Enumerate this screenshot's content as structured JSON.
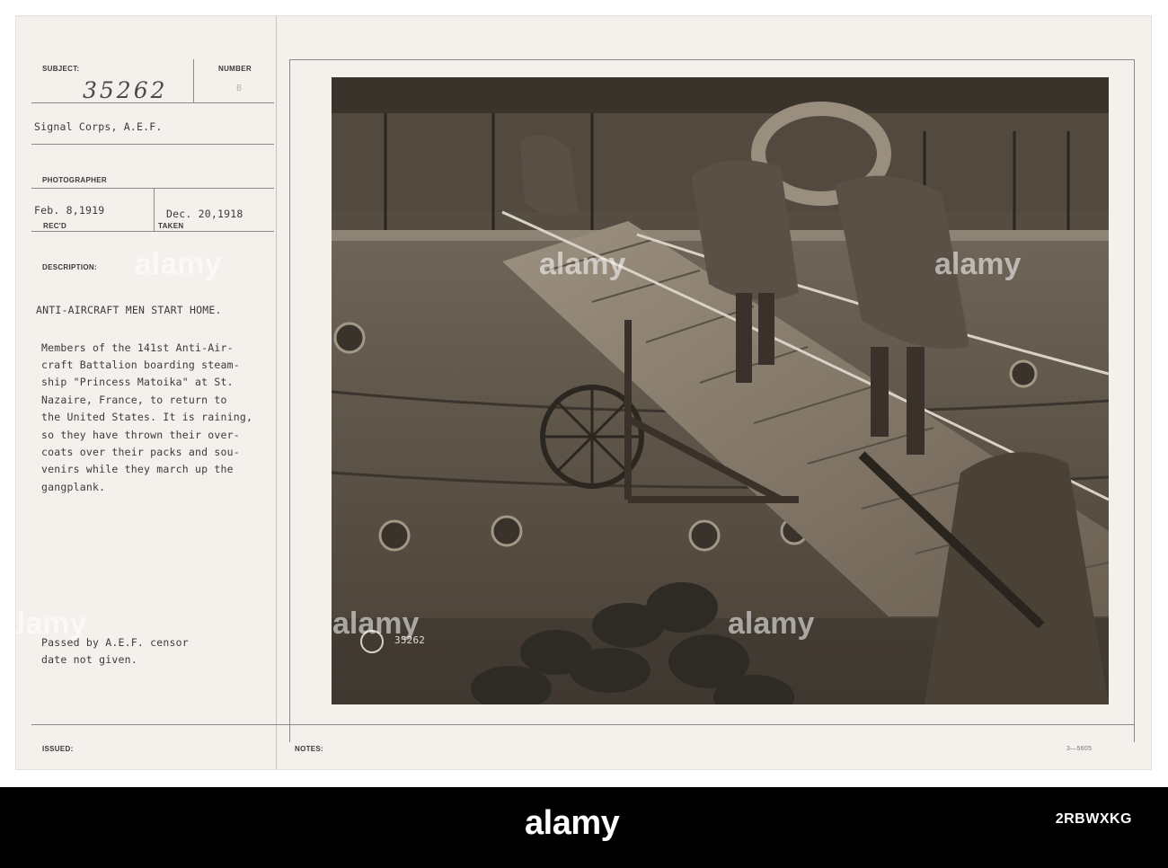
{
  "card": {
    "subject_label": "SUBJECT:",
    "number_label": "NUMBER",
    "subject_number": "35262",
    "number_value": "B",
    "source": "Signal Corps, A.E.F.",
    "photographer_label": "PHOTOGRAPHER",
    "received_date": "Feb. 8,1919",
    "received_label": "REC'D",
    "taken_date": "Dec. 20,1918",
    "taken_label": "TAKEN",
    "description_label": "DESCRIPTION:",
    "headline": "ANTI-AIRCRAFT MEN START HOME.",
    "description_lines": [
      "Members of the 141st Anti-Air-",
      "craft Battalion boarding steam-",
      "ship \"Princess Matoika\" at St.",
      "Nazaire, France, to return to",
      "the United States. It is raining,",
      "so they have thrown their over-",
      "coats over their packs and sou-",
      "venirs while they march up the",
      "gangplank."
    ],
    "censor_lines": [
      "Passed by A.E.F. censor",
      "date not given."
    ],
    "issued_label": "ISSUED:",
    "notes_label": "NOTES:",
    "form_number": "3—5605"
  },
  "photo": {
    "stamp_number": "35262"
  },
  "watermark": {
    "logo_text": "alamy",
    "stock_id": "2RBWXKG"
  }
}
